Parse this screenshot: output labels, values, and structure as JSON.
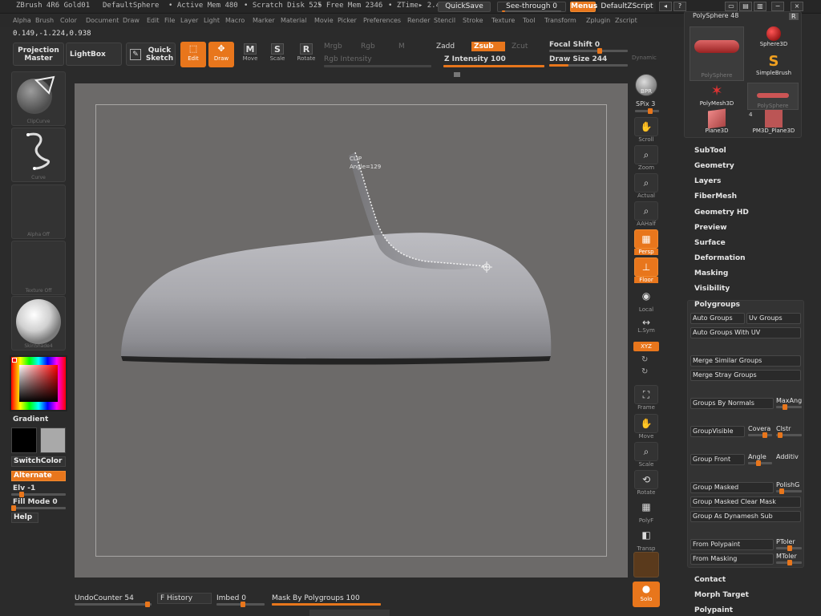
{
  "titlebar": {
    "app": "ZBrush 4R6 Gold01",
    "doc": "DefaultSphere",
    "active_mem": "• Active Mem 480",
    "scratch": "• Scratch Disk 525",
    "free_mem": "• Free Mem 2346",
    "ztime": "• ZTime▸ 2.4",
    "quicksave": "QuickSave",
    "seethrough": "See-through  0",
    "menus": "Menus",
    "script": "DefaultZScript"
  },
  "menubar": [
    "Alpha",
    "Brush",
    "Color",
    "Document",
    "Draw",
    "Edit",
    "File",
    "Layer",
    "Light",
    "Macro",
    "Marker",
    "Material",
    "Movie",
    "Picker",
    "Preferences",
    "Render",
    "Stencil",
    "Stroke",
    "Texture",
    "Tool",
    "Transform",
    "Zplugin",
    "Zscript"
  ],
  "coords": "0.149,-1.224,0.938",
  "toolbar": {
    "projection_master": "Projection Master",
    "lightbox": "LightBox",
    "quick_sketch": "Quick Sketch",
    "edit": "Edit",
    "draw": "Draw",
    "move": "Move",
    "scale": "Scale",
    "rotate": "Rotate",
    "mrgb": "Mrgb",
    "rgb": "Rgb",
    "m": "M",
    "rgb_intensity": "Rgb Intensity",
    "zadd": "Zadd",
    "zsub": "Zsub",
    "zcut": "Zcut",
    "z_intensity": "Z Intensity 100",
    "focal_shift": "Focal Shift 0",
    "draw_size": "Draw Size 244",
    "dynamic": "Dynamic"
  },
  "left": {
    "brush": "ClipCurve",
    "stroke": "Curve",
    "alpha": "Alpha Off",
    "texture": "Texture Off",
    "material": "SkinShade4",
    "gradient": "Gradient",
    "switchcolor": "SwitchColor",
    "alternate": "Alternate",
    "elv": "Elv -1",
    "fillmode": "Fill Mode 0",
    "help": "Help"
  },
  "curve_label": {
    "line1": "CLIP",
    "line2": "Angle=129"
  },
  "shelf": [
    "BPR",
    "SPix 3",
    "Scroll",
    "Zoom",
    "Actual",
    "AAHalf",
    "Persp",
    "Floor",
    "Local",
    "L.Sym",
    "XYZ",
    "Frame",
    "Move",
    "Scale",
    "Rotate",
    "PolyF",
    "Transp",
    "Solo"
  ],
  "palette": {
    "header": "PolySphere 48",
    "r": "R",
    "tools": [
      "PolySphere",
      "Sphere3D",
      "SimpleBrush",
      "PolyMesh3D",
      "PolySphere",
      "Plane3D",
      "PM3D_Plane3D"
    ],
    "count": "4"
  },
  "tool_menu": [
    "SubTool",
    "Geometry",
    "Layers",
    "FiberMesh",
    "Geometry HD",
    "Preview",
    "Surface",
    "Deformation",
    "Masking",
    "Visibility"
  ],
  "polygroups": {
    "title": "Polygroups",
    "auto_groups": "Auto Groups",
    "uv_groups": "Uv Groups",
    "auto_groups_uv": "Auto Groups With UV",
    "merge_similar": "Merge Similar Groups",
    "merge_stray": "Merge Stray Groups",
    "groups_by_normals": "Groups By Normals",
    "maxang": "MaxAng",
    "groupvisible": "GroupVisible",
    "covera": "Covera",
    "clstr": "Clstr",
    "group_front": "Group Front",
    "angle": "Angle",
    "additi": "Additiv",
    "group_masked": "Group Masked",
    "polish": "PolishG",
    "group_masked_clear": "Group Masked Clear Mask",
    "group_as_dynamesh": "Group As Dynamesh Sub",
    "from_polypaint": "From Polypaint",
    "ptoler": "PToler",
    "from_masking": "From Masking",
    "mtoler": "MToler"
  },
  "tool_menu_bottom": [
    "Contact",
    "Morph Target",
    "Polypaint"
  ],
  "bottom": {
    "undo": "UndoCounter 54",
    "history": "F History",
    "imbed": "Imbed 0",
    "mask_by_pg": "Mask By Polygroups 100"
  },
  "colors": {
    "accent": "#e8761c",
    "canvas": "#6c6a69",
    "panel": "#2b2b2b"
  }
}
